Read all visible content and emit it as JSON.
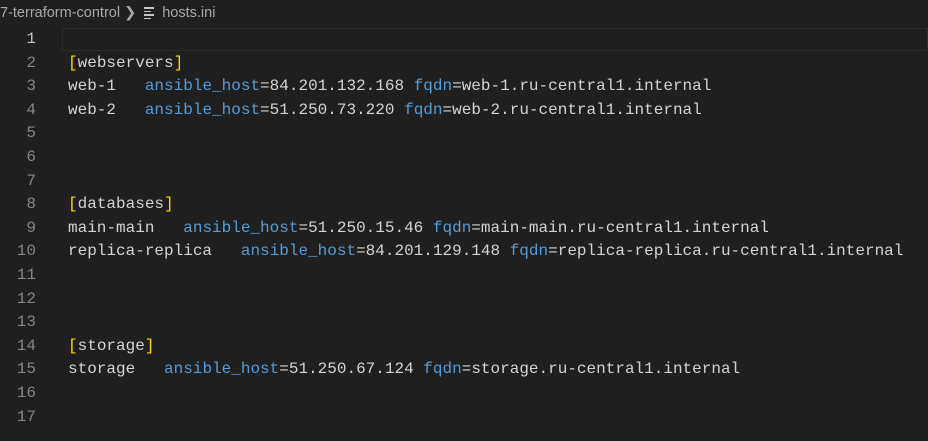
{
  "breadcrumb": {
    "folder": "7-terraform-control",
    "file": "hosts.ini",
    "file_icon": "lines-icon"
  },
  "lines": [
    {
      "n": "1",
      "type": "empty"
    },
    {
      "n": "2",
      "type": "section",
      "name": "webservers"
    },
    {
      "n": "3",
      "type": "host",
      "host": "web-1",
      "pad": "   ",
      "k1": "ansible_host",
      "v1": "84.201.132.168",
      "k2": "fqdn",
      "v2": "web-1.ru-central1.internal"
    },
    {
      "n": "4",
      "type": "host",
      "host": "web-2",
      "pad": "   ",
      "k1": "ansible_host",
      "v1": "51.250.73.220",
      "k2": "fqdn",
      "v2": "web-2.ru-central1.internal"
    },
    {
      "n": "5",
      "type": "empty"
    },
    {
      "n": "6",
      "type": "empty"
    },
    {
      "n": "7",
      "type": "empty"
    },
    {
      "n": "8",
      "type": "section",
      "name": "databases"
    },
    {
      "n": "9",
      "type": "host",
      "host": "main-main",
      "pad": "   ",
      "k1": "ansible_host",
      "v1": "51.250.15.46",
      "k2": "fqdn",
      "v2": "main-main.ru-central1.internal"
    },
    {
      "n": "10",
      "type": "host",
      "host": "replica-replica",
      "pad": "   ",
      "k1": "ansible_host",
      "v1": "84.201.129.148",
      "k2": "fqdn",
      "v2": "replica-replica.ru-central1.internal"
    },
    {
      "n": "11",
      "type": "empty"
    },
    {
      "n": "12",
      "type": "empty"
    },
    {
      "n": "13",
      "type": "empty"
    },
    {
      "n": "14",
      "type": "section",
      "name": "storage"
    },
    {
      "n": "15",
      "type": "host",
      "host": "storage",
      "pad": "   ",
      "k1": "ansible_host",
      "v1": "51.250.67.124",
      "k2": "fqdn",
      "v2": "storage.ru-central1.internal"
    },
    {
      "n": "16",
      "type": "empty"
    },
    {
      "n": "17",
      "type": "empty"
    }
  ]
}
